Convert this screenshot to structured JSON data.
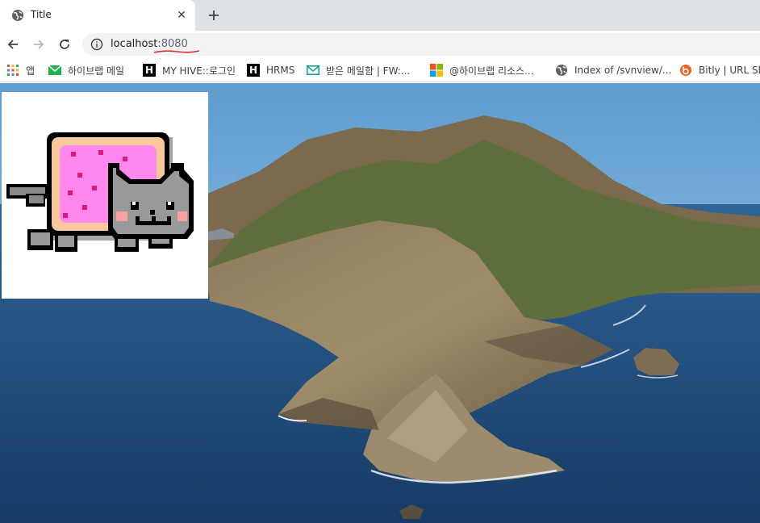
{
  "tab": {
    "title": "Title",
    "favicon": "globe-icon",
    "close": "close-icon"
  },
  "new_tab": {
    "icon": "plus-icon"
  },
  "toolbar": {
    "back": "back-arrow-icon",
    "forward": "forward-arrow-icon",
    "reload": "reload-icon"
  },
  "omnibox": {
    "host": "localhost",
    "port": ":8080",
    "icon": "info-icon"
  },
  "bookmarks": [
    {
      "label": "앱",
      "icon": "apps-grid-icon"
    },
    {
      "label": "하이브랩 메일",
      "icon": "mail-green-icon"
    },
    {
      "label": "MY HIVE::로그인",
      "icon": "h-logo-icon",
      "glyph": "H"
    },
    {
      "label": "HRMS",
      "icon": "h-logo-icon",
      "glyph": "H"
    },
    {
      "label": "받은 메일함 | FW:...",
      "icon": "mail-teal-icon"
    },
    {
      "label": "@하이브랩 리소스...",
      "icon": "microsoft-logo-icon"
    },
    {
      "label": "Index of /svnview/...",
      "icon": "globe-icon"
    },
    {
      "label": "Bitly | URL Sho",
      "icon": "bitly-icon"
    }
  ],
  "colors": {
    "tabstrip": "#dee1e6",
    "omnibox": "#f1f3f4",
    "sky": "#6aa6d6",
    "sea": "#1f4a7a",
    "nyan_pink": "#ff77ff",
    "nyan_crust": "#ffcc99",
    "cat_gray": "#999999"
  }
}
